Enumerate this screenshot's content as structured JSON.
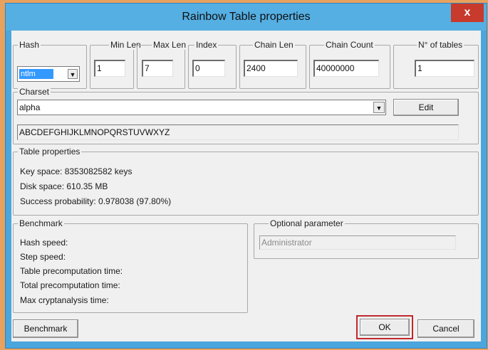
{
  "window": {
    "title": "Rainbow Table properties",
    "close_glyph": "x"
  },
  "params": {
    "hash": {
      "label": "Hash",
      "value": "ntlm"
    },
    "min_len": {
      "label": "Min Len",
      "value": "1"
    },
    "max_len": {
      "label": "Max Len",
      "value": "7"
    },
    "index": {
      "label": "Index",
      "value": "0"
    },
    "chain_len": {
      "label": "Chain Len",
      "value": "2400"
    },
    "chain_count": {
      "label": "Chain Count",
      "value": "40000000"
    },
    "num_tables": {
      "label": "N° of tables",
      "value": "1"
    }
  },
  "charset": {
    "label": "Charset",
    "value": "alpha",
    "edit_label": "Edit",
    "preview": "ABCDEFGHIJKLMNOPQRSTUVWXYZ"
  },
  "table_properties": {
    "label": "Table properties",
    "key_space": "Key space: 8353082582 keys",
    "disk_space": "Disk space: 610.35 MB",
    "success_probability": "Success probability: 0.978038 (97.80%)"
  },
  "benchmark": {
    "label": "Benchmark",
    "hash_speed": "Hash speed:",
    "step_speed": "Step speed:",
    "table_precomputation": "Table precomputation time:",
    "total_precomputation": "Total precomputation time:",
    "max_cryptanalysis": "Max cryptanalysis time:"
  },
  "optional": {
    "label": "Optional parameter",
    "value": "Administrator"
  },
  "buttons": {
    "benchmark": "Benchmark",
    "ok": "OK",
    "cancel": "Cancel"
  },
  "colors": {
    "titlebar": "#55afe3",
    "close": "#c73a2c",
    "ok_highlight": "#c0282d",
    "selection": "#3399ff"
  }
}
